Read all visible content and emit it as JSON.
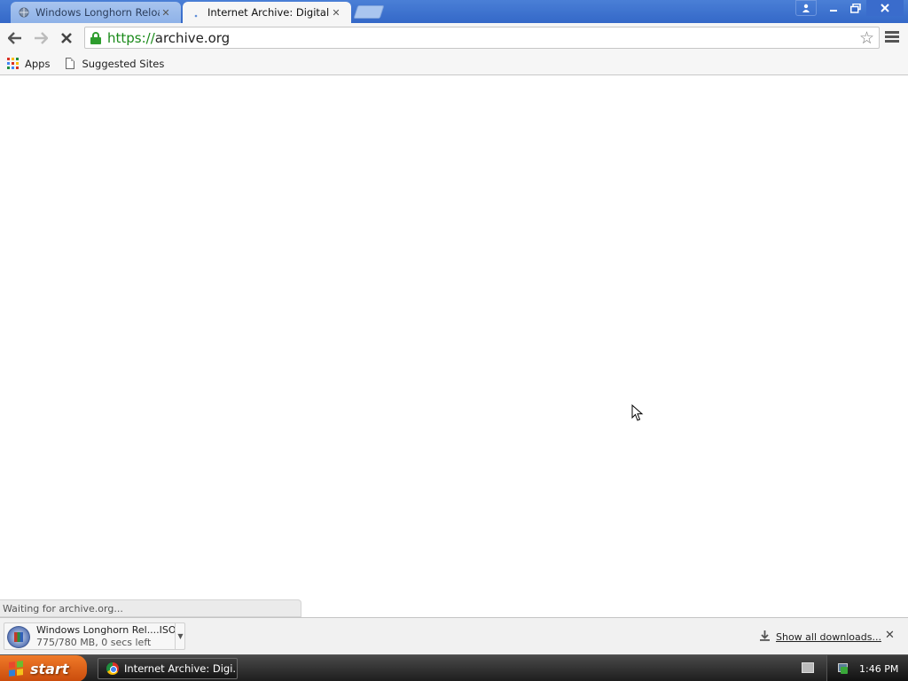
{
  "browser": {
    "tabs": [
      {
        "title": "Windows Longhorn Reloaded",
        "favicon": "globe-icon",
        "active": false
      },
      {
        "title": "Internet Archive: Digital Library",
        "favicon": "loading-spinner-icon",
        "active": true
      }
    ],
    "address_bar": {
      "scheme": "https://",
      "host": "archive.org"
    },
    "bookmarks": [
      {
        "label": "Apps",
        "icon": "apps-grid-icon"
      },
      {
        "label": "Suggested Sites",
        "icon": "page-icon"
      }
    ],
    "status_text": "Waiting for archive.org..."
  },
  "download_shelf": {
    "item": {
      "name": "Windows Longhorn Rel....ISO",
      "status": "775/780 MB, 0 secs left",
      "progress": 0.994,
      "icon": "disc-image-icon"
    },
    "show_all_label": "Show all downloads..."
  },
  "taskbar": {
    "start_label": "start",
    "tasks": [
      {
        "label": "Internet Archive: Digi...",
        "icon": "chrome-icon"
      }
    ],
    "clock": "1:46 PM"
  },
  "colors": {
    "title_bar": "#3468c8",
    "secure_green": "#1a8a1a",
    "start_button": "#e0651c",
    "taskbar": "#2a2a2a"
  }
}
